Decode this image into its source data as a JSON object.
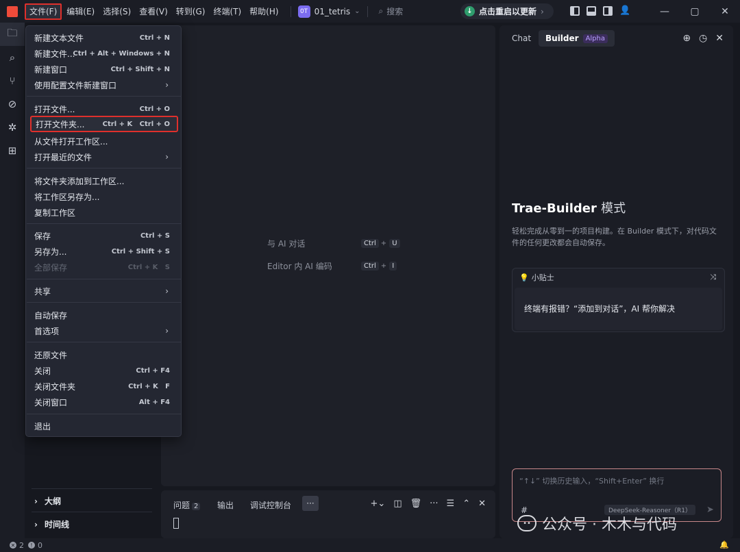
{
  "titlebar": {
    "menus": [
      "文件(F)",
      "编辑(E)",
      "选择(S)",
      "查看(V)",
      "转到(G)",
      "终端(T)",
      "帮助(H)"
    ],
    "project_badge": "0T",
    "project_name": "01_tetris",
    "search_label": "搜索",
    "update_label": "点击重启以更新"
  },
  "file_menu": {
    "items": [
      {
        "label": "新建文本文件",
        "shortcut": "Ctrl + N"
      },
      {
        "label": "新建文件...",
        "shortcut": "Ctrl + Alt + Windows + N"
      },
      {
        "label": "新建窗口",
        "shortcut": "Ctrl + Shift + N"
      },
      {
        "label": "使用配置文件新建窗口",
        "shortcut": ""
      },
      {
        "label": "打开文件...",
        "shortcut": "Ctrl + O"
      },
      {
        "label": "打开文件夹...",
        "shortcut": "Ctrl + K   Ctrl + O"
      },
      {
        "label": "从文件打开工作区...",
        "shortcut": ""
      },
      {
        "label": "打开最近的文件",
        "shortcut": ""
      },
      {
        "label": "将文件夹添加到工作区...",
        "shortcut": ""
      },
      {
        "label": "将工作区另存为...",
        "shortcut": ""
      },
      {
        "label": "复制工作区",
        "shortcut": ""
      },
      {
        "label": "保存",
        "shortcut": "Ctrl + S"
      },
      {
        "label": "另存为...",
        "shortcut": "Ctrl + Shift + S"
      },
      {
        "label": "全部保存",
        "shortcut": "Ctrl + K   S"
      },
      {
        "label": "共享",
        "shortcut": ""
      },
      {
        "label": "自动保存",
        "shortcut": ""
      },
      {
        "label": "首选项",
        "shortcut": ""
      },
      {
        "label": "还原文件",
        "shortcut": ""
      },
      {
        "label": "关闭",
        "shortcut": "Ctrl + F4"
      },
      {
        "label": "关闭文件夹",
        "shortcut": "Ctrl + K   F"
      },
      {
        "label": "关闭窗口",
        "shortcut": "Alt + F4"
      },
      {
        "label": "退出",
        "shortcut": ""
      }
    ]
  },
  "sidebar": {
    "outline_label": "大纲",
    "timeline_label": "时间线"
  },
  "editor": {
    "hint_ai_chat": "与 AI 对话",
    "hint_ai_chat_keys": [
      "Ctrl",
      "U"
    ],
    "hint_inline_ai": "Editor 内 AI 编码",
    "hint_inline_ai_keys": [
      "Ctrl",
      "I"
    ]
  },
  "bottom_panel": {
    "tabs": [
      "问题",
      "输出",
      "调试控制台"
    ],
    "problems_count": "2",
    "more": "···"
  },
  "right_panel": {
    "tab_chat": "Chat",
    "tab_builder": "Builder",
    "builder_badge": "Alpha",
    "title": "Trae-Builder",
    "title_mode": "模式",
    "description": "轻松完成从零到一的项目构建。在 Builder 模式下，对代码文件的任何更改都会自动保存。",
    "tip_heading": "小贴士",
    "tip_text": "终端有报错？“添加到对话”，AI 帮你解决",
    "input_placeholder": "“↑↓” 切换历史输入，“Shift+Enter” 换行",
    "input_hash": "#",
    "model_label": "DeepSeek-Reasoner（R1）"
  },
  "watermark": "公众号 · 木木与代码",
  "statusbar": {
    "errors": "2",
    "warnings": "0"
  },
  "colors": {
    "highlight_red": "#e0302c",
    "accent_purple": "#7b6cf0",
    "update_green": "#2f9d6d"
  }
}
